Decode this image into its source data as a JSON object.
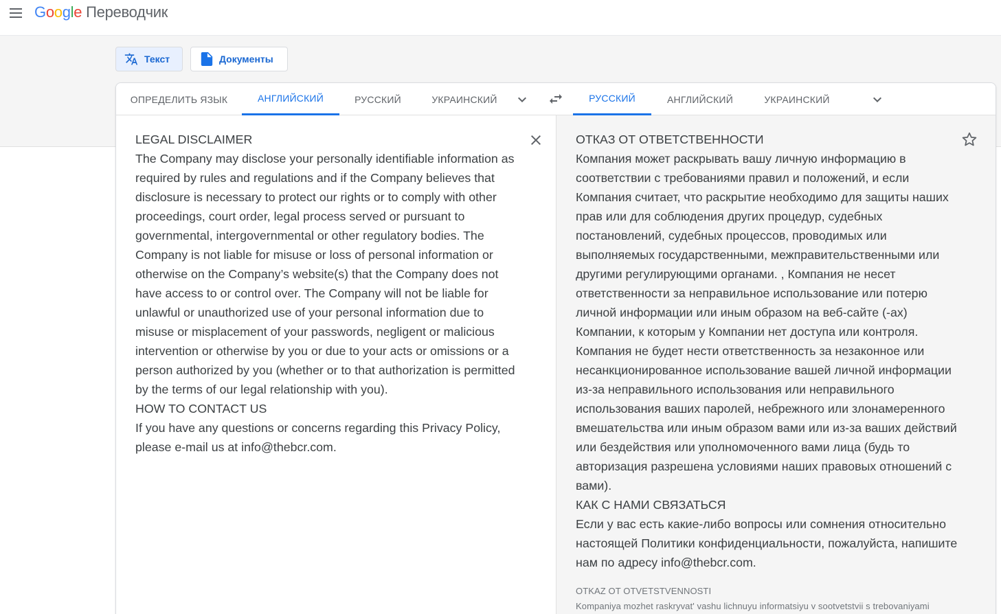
{
  "header": {
    "logo_letters": [
      "G",
      "o",
      "o",
      "g",
      "l",
      "e"
    ],
    "product": "Переводчик",
    "menu_icon": "hamburger-menu-icon"
  },
  "modes": {
    "text_label": "Текст",
    "docs_label": "Документы"
  },
  "source_langs": {
    "detect": "ОПРЕДЕЛИТЬ ЯЗЫК",
    "tabs": [
      "АНГЛИЙСКИЙ",
      "РУССКИЙ",
      "УКРАИНСКИЙ"
    ],
    "active": "АНГЛИЙСКИЙ"
  },
  "target_langs": {
    "tabs": [
      "РУССКИЙ",
      "АНГЛИЙСКИЙ",
      "УКРАИНСКИЙ"
    ],
    "active": "РУССКИЙ"
  },
  "source_text": [
    "LEGAL DISCLAIMER",
    "The Company may disclose your personally identifiable information as required by rules and regulations and if the Company believes that disclosure is necessary to protect our rights or to comply with other proceedings, court order, legal process served or pursuant to governmental, intergovernmental or other regulatory bodies. The Company is not liable for misuse or loss of personal information or otherwise on the Company’s website(s) that the Company does not have access to or control over. The Company will not be liable for unlawful or unauthorized use of your personal information due to misuse or misplacement of your passwords, negligent or malicious intervention or otherwise by you or due to your acts or omissions or a person authorized by you (whether or to that authorization is permitted by the terms of our legal relationship with you).",
    "HOW TO CONTACT US",
    "If you have any questions or concerns regarding this Privacy Policy, please e-mail us at info@thebcr.com."
  ],
  "target_text": [
    "ОТКАЗ ОТ ОТВЕТСТВЕННОСТИ",
    "Компания может раскрывать вашу личную информацию в соответствии с требованиями правил и положений, и если Компания считает, что раскрытие необходимо для защиты наших прав или для соблюдения других процедур, судебных постановлений, судебных процессов, проводимых или выполняемых государственными, межправительственными или другими регулирующими органами. , Компания не несет ответственности за неправильное использование или потерю личной информации или иным образом на веб-сайте (-ах) Компании, к которым у Компании нет доступа или контроля. Компания не будет нести ответственность за незаконное или несанкционированное использование вашей личной информации из-за неправильного использования или неправильного использования ваших паролей, небрежного или злонамеренного вмешательства или иным образом вами или из-за ваших действий или бездействия или уполномоченного вами лица (будь то авторизация разрешена условиями наших правовых отношений с вами).",
    "КАК С НАМИ СВЯЗАТЬСЯ",
    "Если у вас есть какие-либо вопросы или сомнения относительно настоящей Политики конфиденциальности, пожалуйста, напишите нам по адресу info@thebcr.com."
  ],
  "transliteration": [
    "OTKAZ OT OTVETSTVENNOSTI",
    "Kompaniya mozhet raskryvat' vashu lichnuyu informatsiyu v sootvetstvii s trebovaniyami"
  ],
  "icons": {
    "swap": "swap-languages-icon",
    "clear": "close-icon",
    "star": "star-icon",
    "chevron": "chevron-down-icon"
  },
  "colors": {
    "accent": "#1a73e8",
    "band": "#f5f5f5",
    "text": "#3c4043"
  }
}
